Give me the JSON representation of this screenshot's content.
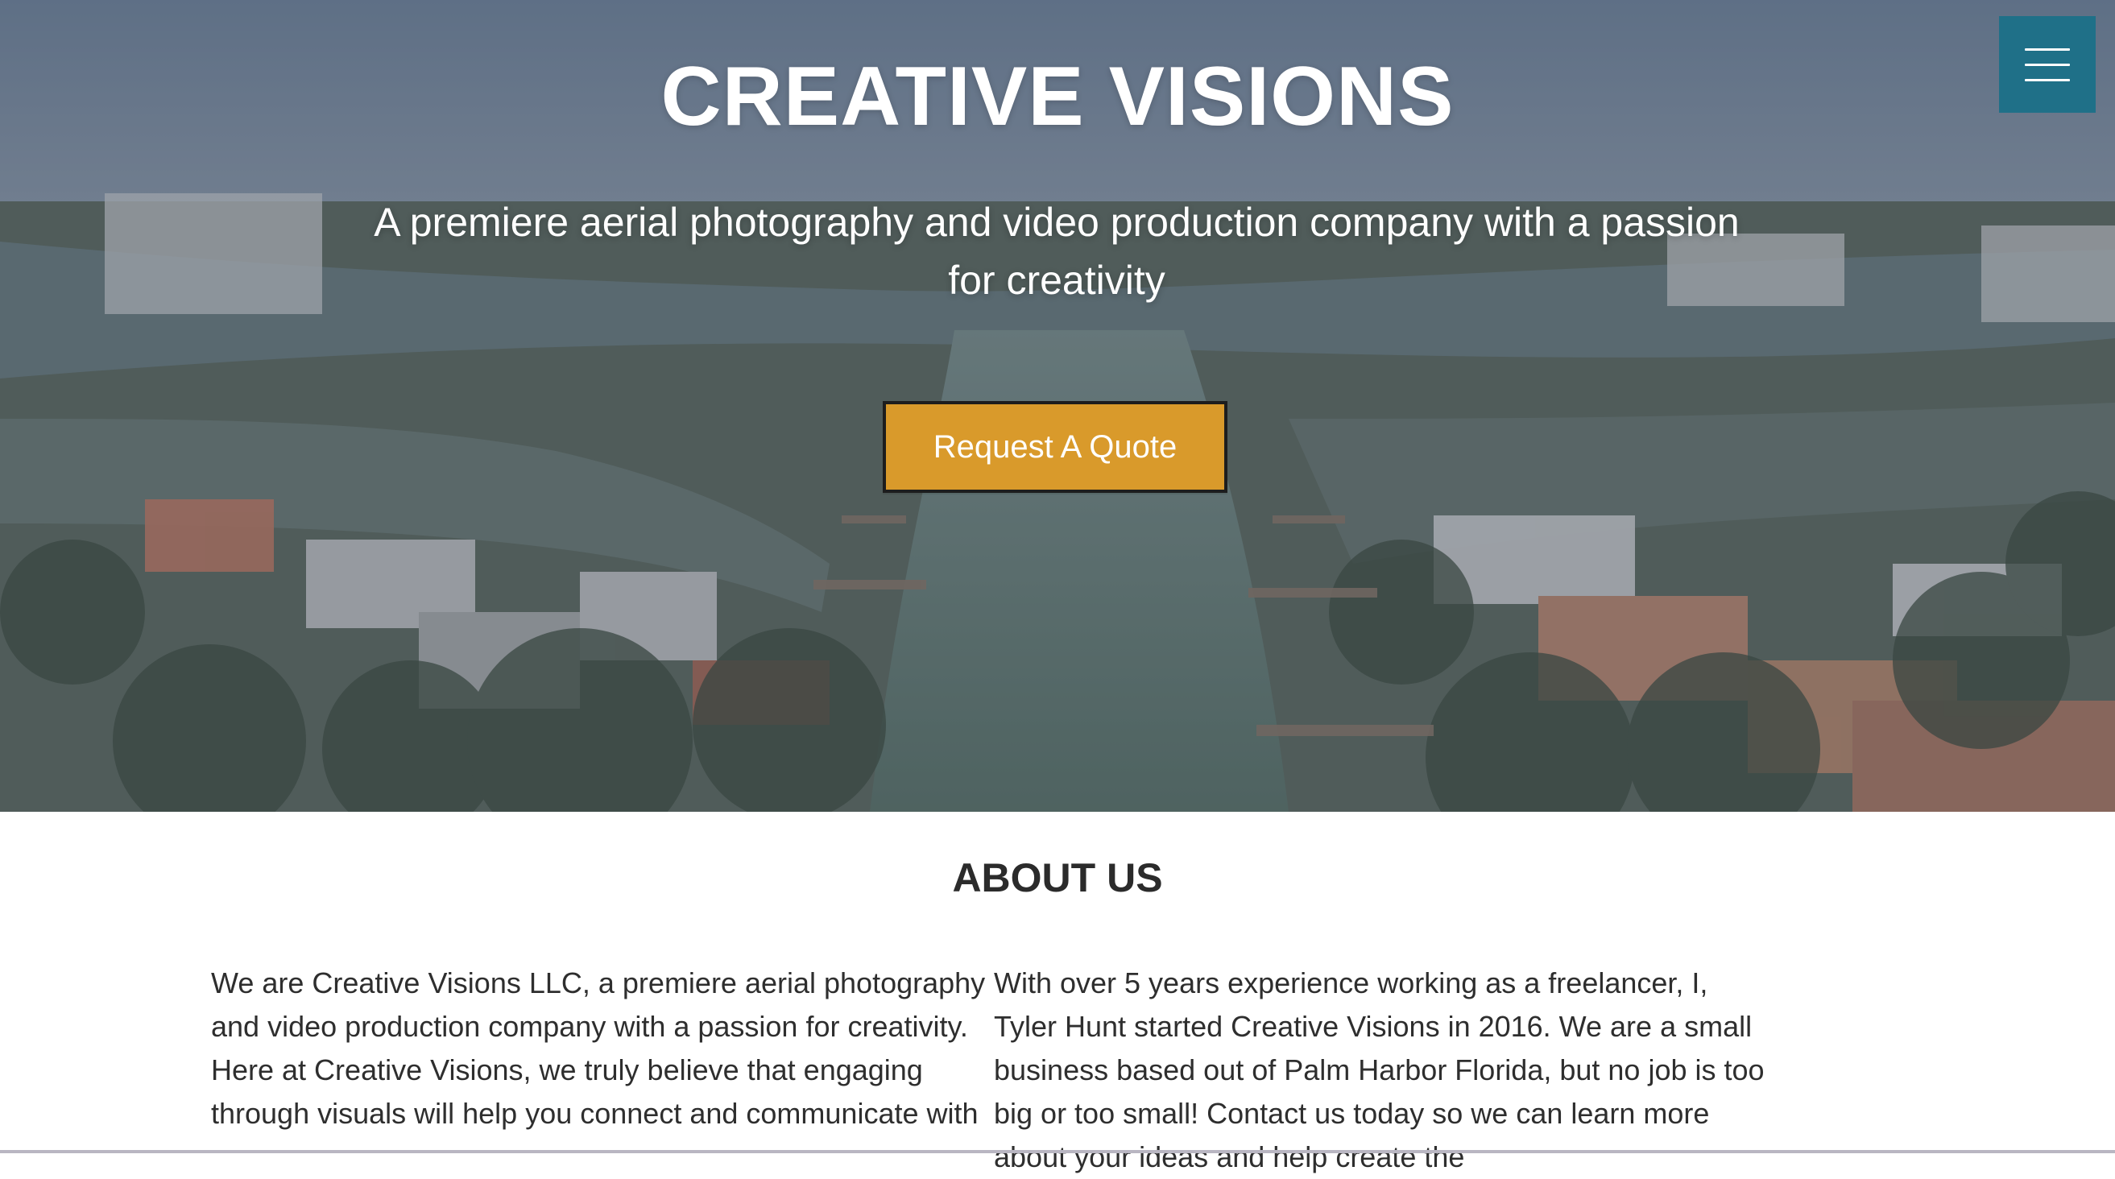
{
  "hero": {
    "title": "CREATIVE VISIONS",
    "subtitle": "A premiere aerial photography and video production company with a passion for creativity",
    "cta_label": "Request A Quote",
    "menu_icon": "hamburger-menu-icon",
    "colors": {
      "menu_bg": "#1f7088",
      "cta_bg": "#d99a2b",
      "text": "#ffffff"
    }
  },
  "about": {
    "title": "ABOUT US",
    "left_paragraph": "We are Creative Visions LLC, a premiere aerial photography and video production company with a passion for creativity. Here at Creative Visions, we truly believe that engaging through visuals will help you connect and communicate with",
    "right_paragraph": "With over 5 years experience working as a freelancer, I, Tyler Hunt started Creative Visions in 2016. We are a small business based out of Palm Harbor Florida, but no job is too big or too small! Contact us today so we can learn more about your ideas and help create the"
  }
}
